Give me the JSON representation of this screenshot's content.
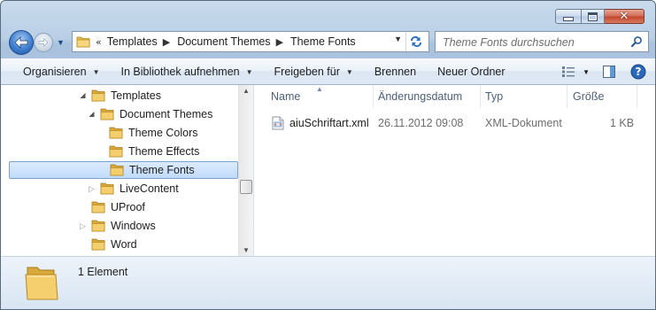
{
  "window": {
    "buttons": {
      "minimize": "minimize",
      "maximize": "maximize",
      "close": "close"
    }
  },
  "address": {
    "overflow": "«",
    "crumbs": [
      "Templates",
      "Document Themes",
      "Theme Fonts"
    ]
  },
  "search": {
    "placeholder": "Theme Fonts durchsuchen"
  },
  "toolbar": {
    "items": [
      "Organisieren",
      "In Bibliothek aufnehmen",
      "Freigeben für",
      "Brennen",
      "Neuer Ordner"
    ]
  },
  "tree": [
    {
      "label": "Templates",
      "level": 1,
      "expander": "open"
    },
    {
      "label": "Document Themes",
      "level": 2,
      "expander": "open"
    },
    {
      "label": "Theme Colors",
      "level": 3,
      "expander": "none"
    },
    {
      "label": "Theme Effects",
      "level": 3,
      "expander": "none"
    },
    {
      "label": "Theme Fonts",
      "level": 3,
      "expander": "none",
      "selected": true
    },
    {
      "label": "LiveContent",
      "level": 2,
      "expander": "closed"
    },
    {
      "label": "UProof",
      "level": 1,
      "expander": "none"
    },
    {
      "label": "Windows",
      "level": 1,
      "expander": "closed"
    },
    {
      "label": "Word",
      "level": 1,
      "expander": "none"
    }
  ],
  "columns": {
    "name": "Name",
    "date": "Änderungsdatum",
    "type": "Typ",
    "size": "Größe"
  },
  "files": [
    {
      "name": "aiuSchriftart.xml",
      "date": "26.11.2012 09:08",
      "type": "XML-Dokument",
      "size": "1 KB"
    }
  ],
  "details": {
    "count": "1 Element"
  },
  "colors": {
    "selection": "#cce4fb",
    "accent": "#3f7fd2",
    "folder": "#e8c25a"
  },
  "icons": [
    "back-arrow-icon",
    "forward-arrow-icon",
    "folder-icon",
    "refresh-icon",
    "search-icon",
    "view-options-icon",
    "preview-pane-icon",
    "help-icon",
    "xml-file-icon"
  ]
}
